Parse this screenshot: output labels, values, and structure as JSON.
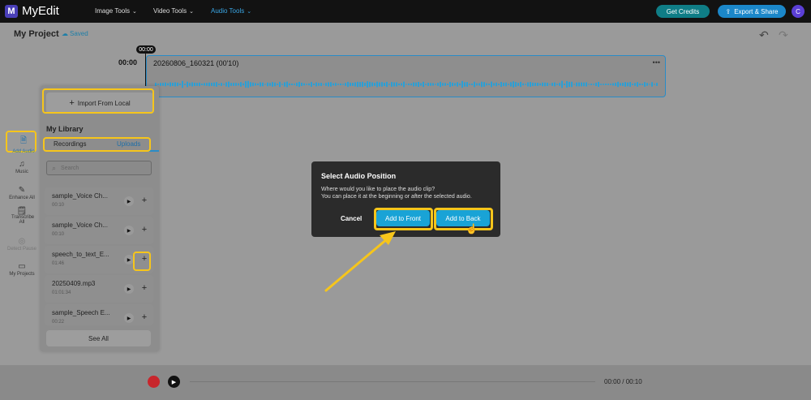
{
  "app": {
    "brand": "MyEdit"
  },
  "nav": [
    {
      "label": "Image Tools"
    },
    {
      "label": "Video Tools"
    },
    {
      "label": "Audio Tools"
    }
  ],
  "header": {
    "credits": "Get Credits",
    "export": "Export & Share",
    "avatar": "C"
  },
  "project": {
    "title": "My Project",
    "saved": "Saved"
  },
  "timeline": {
    "start": "00:00",
    "playhead": "00:00",
    "clip_title": "20260806_160321  (00'10)"
  },
  "sidebar": [
    {
      "label": "Add Audio"
    },
    {
      "label": "Music"
    },
    {
      "label": "Enhance All"
    },
    {
      "label": "Transcribe All"
    },
    {
      "label": "Detect Pause"
    },
    {
      "label": "My Projects"
    }
  ],
  "panel": {
    "import": "Import From Local",
    "library_title": "My Library",
    "tabs": [
      "Recordings",
      "Uploads"
    ],
    "search_placeholder": "Search",
    "items": [
      {
        "name": "sample_Voice Ch...",
        "dur": "00:10"
      },
      {
        "name": "sample_Voice Ch...",
        "dur": "00:10"
      },
      {
        "name": "speech_to_text_E...",
        "dur": "01:46"
      },
      {
        "name": "20250409.mp3",
        "dur": "01:01:34"
      },
      {
        "name": "sample_Speech E...",
        "dur": "00:22"
      }
    ],
    "see_all": "See All"
  },
  "dialog": {
    "title": "Select Audio Position",
    "line1": "Where would you like to place the audio clip?",
    "line2": "You can place it at the beginning or after the selected audio.",
    "cancel": "Cancel",
    "front": "Add to Front",
    "back": "Add to Back"
  },
  "player": {
    "timecode": "00:00 / 00:10"
  },
  "colors": {
    "accent": "#19a3d6",
    "highlight": "#f6c51b",
    "record": "#c8262c"
  }
}
